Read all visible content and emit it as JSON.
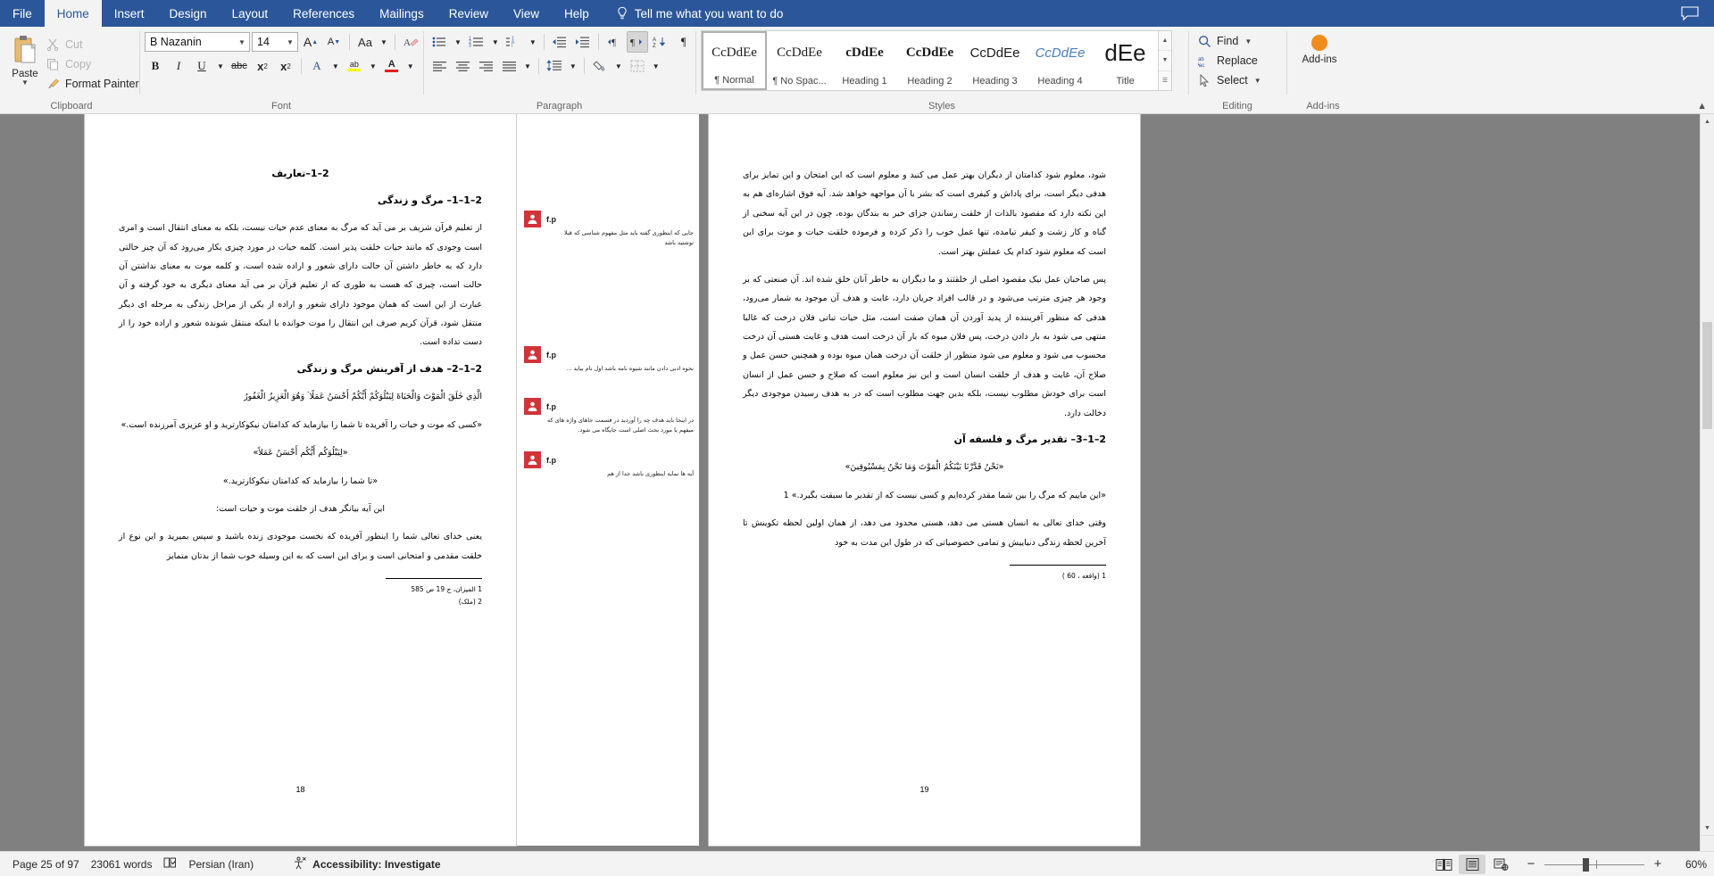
{
  "app": {
    "title": "Microsoft Word",
    "tabs": [
      {
        "id": "file",
        "label": "File"
      },
      {
        "id": "home",
        "label": "Home"
      },
      {
        "id": "insert",
        "label": "Insert"
      },
      {
        "id": "design",
        "label": "Design"
      },
      {
        "id": "layout",
        "label": "Layout"
      },
      {
        "id": "references",
        "label": "References"
      },
      {
        "id": "mailings",
        "label": "Mailings"
      },
      {
        "id": "review",
        "label": "Review"
      },
      {
        "id": "view",
        "label": "View"
      },
      {
        "id": "help",
        "label": "Help"
      }
    ],
    "tell_me": "Tell me what you want to do"
  },
  "ribbon": {
    "clipboard": {
      "group_label": "Clipboard",
      "paste": "Paste",
      "cut": "Cut",
      "copy": "Copy",
      "format_painter": "Format Painter"
    },
    "font": {
      "group_label": "Font",
      "font_name": "B Nazanin",
      "font_size": "14",
      "grow_font": "A",
      "shrink_font": "A",
      "change_case": "Aa",
      "clear_formatting": "A",
      "bold": "B",
      "italic": "I",
      "underline": "U",
      "strikethrough": "abc",
      "subscript": "x",
      "subscript_num": "2",
      "superscript": "x",
      "superscript_num": "2",
      "text_effects": "A",
      "highlight": "ab",
      "font_color": "A"
    },
    "paragraph": {
      "group_label": "Paragraph"
    },
    "styles": {
      "group_label": "Styles",
      "items": [
        {
          "preview": "CcDdEe",
          "name": "¶ Normal",
          "selected": true
        },
        {
          "preview": "CcDdEe",
          "name": "¶ No Spac...",
          "selected": false
        },
        {
          "preview": "cDdEe",
          "name": "Heading 1",
          "selected": false
        },
        {
          "preview": "CcDdEe",
          "name": "Heading 2",
          "selected": false
        },
        {
          "preview": "CcDdEe",
          "name": "Heading 3",
          "selected": false
        },
        {
          "preview": "CcDdEe",
          "name": "Heading 4",
          "selected": false
        },
        {
          "preview": "dEe",
          "name": "Title",
          "selected": false
        }
      ]
    },
    "editing": {
      "group_label": "Editing",
      "find": "Find",
      "replace": "Replace",
      "select": "Select"
    },
    "addins": {
      "group_label": "Add-ins",
      "button": "Add-ins"
    }
  },
  "document": {
    "left_page": {
      "number": "18",
      "heading_main": "2–1–تعاریف",
      "heading_sub1": "2–1–1– مرگ و زندگی",
      "para1": "از تعلیم قرآن شریف بر می آید که مرگ به معنای عدم حیات نیست، بلکه به معنای انتقال است و امری است وجودی که مانند حیات خلقت پذیر است. کلمه حیات در مورد چیزی بکار می‌رود که آن چیز حالتی دارد که به خاطر داشتن آن حالت دارای شعور و اراده شده است، و کلمه موت به معنای نداشتن آن حالت است، چیزی که هست به طوری که از تعلیم قرآن بر می آید معنای دیگری به خود گرفته و آن عبارت از این است که همان موجود دارای شعور و اراده از یکی از مراحل زندگی به مرحله ای دیگر منتقل شود، قرآن کریم صرف این انتقال را موت خوانده با اینکه منتقل شونده شعور و اراده خود را از دست تداده است.",
      "heading_sub2": "2–1–2– هدف از آفرینش مرگ و زندگی",
      "arabic1": "الَّذِي خَلَقَ الْمَوْتَ وَالْحَيَاةَ لِيَبْلُوَكُمْ أَيُّكُمْ أَحْسَنُ عَمَلًا ۘ وَهُوَ الْعَزِيزُ الْغَفُورُ",
      "trans1": "«کسی که موت و حیات را آفریده تا شما را بیازماید که کدامتان نیکوکارترید و او عزیزی آمرزنده است.»",
      "arabic2": "«لِيَبْلُوَكُم أَيُّكُم أَحْسَنُ عَمَلاً»",
      "trans2": "«تا شما را بیازماید که کدامتان نیکوکارترید.»",
      "para2": "این آیه بیانگر هدف از خلقت موت و حیات است:",
      "para3": "یعنی خدای تعالی شما را اینطور آفریده که نخست موجودی زنده باشید و سپس بمیرید و این نوع از خلقت مقدمی و امتحانی است و برای این است که به این وسیله خوب شما از بدتان متمایز",
      "footnote1": "1 المیزان، ج 19 ص 585",
      "footnote2": "2 (ملک)"
    },
    "right_page": {
      "number": "19",
      "para1": "شود، معلوم شود کدامتان از دیگران بهتر عمل می کنید و معلوم است که این امتحان و این تمایز برای هدفی دیگر است، برای پاداش و کیفری است که بشر با آن مواجهه خواهد شد. آیه فوق اشاره‌ای هم به این نکته دارد که مقصود بالذات از خلقت رساندن جزای خیر به بندگان بوده، چون در این آیه سخنی از گناه و کار زشت و کیفر تیامده، تنها عمل خوب را ذکر کرده و فرموده خلقت حیات و موت برای این است که معلوم شود کدام یک عملش بهتر است.",
      "para2": "پس صاحبان عمل نیک مقصود اصلی از خلقتند و ما دیگران به خاطر آنان خلق شده اند. آن صنعتی که بر وجود هر چیزی مترتب می‌شود و در قالب افراد جریان دارد، غایت و هدف آن موجود به شمار می‌رود، هدفی که منظور آفریننده از پدید آوردن آن همان صفت است، مثل حیات تباتی فلان درخت که غالبا منتهی می شود به بار دادن درخت، پس فلان میوه که بار آن درخت است هدف و غایت هستی آن درخت محسوب می شود و معلوم می شود منظور از خلقت آن درخت همان میوه بوده و همچنین حسن عمل و صلاح آن، غایت و هدف از خلقت انسان است و این نیز معلوم است که صلاح و حسن عمل از انسان است برای خودش مطلوب نیست، بلکه بدین جهت مطلوب است که در به هدف رسیدن موجودی دیگر دخالت دارد.",
      "heading": "2–1–3– تقدیر مرگ و فلسفه آن",
      "arabic1": "«نَحْنُ قَدَّرْنَا بَيْنَكُمُ الْمَوْتَ وَمَا نَحْنُ بِمَسْبُوقِينَ»",
      "trans1": "«این ماییم که مرگ را بین شما مقدر کرده‌ایم و کسی نیست که از تقدیر ما سبقت بگیرد.» 1",
      "para3": "وقتی خدای تعالی به انسان هستی می دهد، هستی محدود می دهد، از همان اولین لحظه تکوینش تا آخرین لحظه زندگی دنیاییش و تمامی خصوصیاتی که در طول این مدت به خود",
      "footnote1": "1 (واقعه ، 60 )"
    },
    "comments": [
      {
        "author": "f.p",
        "text": "جایی که اینطوری گفته باید مثل مفهوم شناسی که قبلا نوشتید باشد"
      },
      {
        "author": "f.p",
        "text": "نحوه ادبی دادن مانند شیوه نامه باشد اول نام بیاید …"
      },
      {
        "author": "f.p",
        "text": "در اینجا باید هدف چه را آوردید در قسمت جاهای واژه های که میفهم یا مورد بحث اصلی است جایگاه می شود."
      },
      {
        "author": "f.p",
        "text": "آیه ها نمایه اینطوری باشد جدا از هم"
      }
    ]
  },
  "status_bar": {
    "page": "Page 25 of 97",
    "words": "23061 words",
    "language": "Persian (Iran)",
    "accessibility": "Accessibility: Investigate",
    "zoom_percent": "60%",
    "zoom_minus": "−",
    "zoom_plus": "+",
    "views": [
      {
        "id": "read-mode",
        "label": "Read Mode",
        "active": false
      },
      {
        "id": "print-layout",
        "label": "Print Layout",
        "active": true
      },
      {
        "id": "web-layout",
        "label": "Web Layout",
        "active": false
      }
    ]
  }
}
